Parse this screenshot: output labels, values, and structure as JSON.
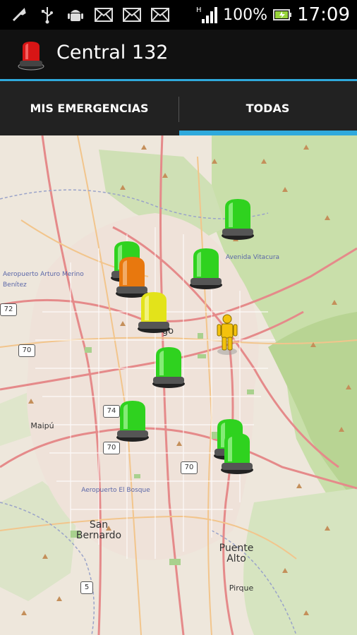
{
  "status_bar": {
    "battery_text": "100%",
    "time": "17:09",
    "icons": [
      "wrench-icon",
      "usb-icon",
      "android-icon",
      "mail-icon",
      "mail-icon",
      "mail-icon",
      "signal-icon",
      "battery-icon"
    ]
  },
  "action_bar": {
    "title": "Central 132",
    "icon": "siren-icon"
  },
  "tabs": [
    {
      "label": "MIS EMERGENCIAS",
      "selected": false
    },
    {
      "label": "TODAS",
      "selected": true
    }
  ],
  "colors": {
    "accent": "#2fa9dc",
    "marker_green": "#2fd21f",
    "marker_orange": "#e8780e",
    "marker_yellow": "#e3e31a"
  },
  "map": {
    "labels": {
      "san_bernardo": "San\nBernardo",
      "puente_alto": "Puente\nAlto",
      "maipu": "Maipú",
      "pirque": "Pirque",
      "go": "go",
      "aeropuerto": "Aeropuerto Arturo Merino Benítez",
      "vitacura": "Avenida Vitacura",
      "aeropuerto_rural": "Aeropuerto El Bosque"
    },
    "route_shields": [
      "72",
      "70",
      "74",
      "70",
      "70",
      "5"
    ],
    "markers": [
      {
        "type": "siren",
        "color": "green"
      },
      {
        "type": "siren",
        "color": "green"
      },
      {
        "type": "siren",
        "color": "orange"
      },
      {
        "type": "siren",
        "color": "green"
      },
      {
        "type": "siren",
        "color": "yellow"
      },
      {
        "type": "siren",
        "color": "green"
      },
      {
        "type": "siren",
        "color": "green"
      },
      {
        "type": "siren",
        "color": "green"
      },
      {
        "type": "siren",
        "color": "green"
      },
      {
        "type": "person",
        "color": "yellow"
      }
    ]
  }
}
